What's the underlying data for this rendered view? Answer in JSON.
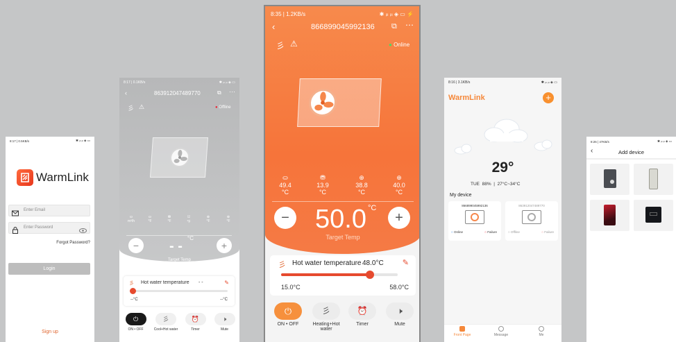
{
  "p1": {
    "status_time": "8:17 | 0.5KB/s",
    "status_right": "✱ ᵢₗₗ ᵢₗₗ ◈ ▭",
    "app_name": "WarmLink",
    "email_placeholder": "Enter Email",
    "password_placeholder": "Enter Password",
    "forgot": "Forgot Password?",
    "login": "Login",
    "signup": "Sign up"
  },
  "p2": {
    "status_time": "8:17 | 0.1KB/s",
    "status_right": "✱ ᵢₗₗ ᵢₗₗ ◈ ▭",
    "device_id": "863912047489770",
    "status": "Offline",
    "units": [
      "m³/h",
      "°F",
      "°F",
      "°F",
      "°F",
      "°F"
    ],
    "temp": "- -",
    "temp_unit": "°C",
    "target": "Target Temp",
    "hw_label": "Hot water temperature",
    "hw_value": "- -",
    "min": "--°C",
    "max": "--°C",
    "controls": [
      "ON • OFF",
      "Cool+Hot water",
      "Timer",
      "Mute"
    ]
  },
  "p3": {
    "status_time": "8:35 | 1.2KB/s",
    "status_right": "✱ ᵢₗₗ ᵢₗₗ ◈ ▭ ⚡",
    "device_id": "866899045992136",
    "status": "Online",
    "readings": [
      {
        "v": "49.4",
        "u": "°C"
      },
      {
        "v": "13.9",
        "u": "°C"
      },
      {
        "v": "38.8",
        "u": "°C"
      },
      {
        "v": "40.0",
        "u": "°C"
      }
    ],
    "temp": "50.0",
    "temp_unit": "°C",
    "target": "Target Temp",
    "hw_label": "Hot water temperature",
    "hw_value": "48.0°C",
    "min": "15.0°C",
    "max": "58.0°C",
    "slider_level": 0.76,
    "controls": [
      "ON • OFF",
      "Heating+Hot water",
      "Timer",
      "Mute"
    ]
  },
  "p4": {
    "status_time": "8:16 | 3.1KB/s",
    "status_right": "✱ ᵢₗₗ ᵢₗₗ ◈ ▭",
    "app_name": "WarmLink",
    "temp": "29°",
    "day": "TUE",
    "humidity": "88%",
    "range": "27°C~34°C",
    "my_device": "My device",
    "devices": [
      {
        "id": "866899045992136",
        "online": "Online",
        "failure": "Failure"
      },
      {
        "id": "863912047489770",
        "online": "Offline",
        "failure": "Failure"
      }
    ],
    "tabs": [
      "Front Page",
      "Message",
      "Me"
    ]
  },
  "p5": {
    "status_time": "8:26 | 47KB/s",
    "status_right": "✱ ᵢₗₗ ᵢₗₗ ◈ ▭",
    "title": "Add device"
  },
  "colors": {
    "orange": "#f67a3f",
    "red": "#e64a2e",
    "gray_bg": "#c5c6c7"
  }
}
